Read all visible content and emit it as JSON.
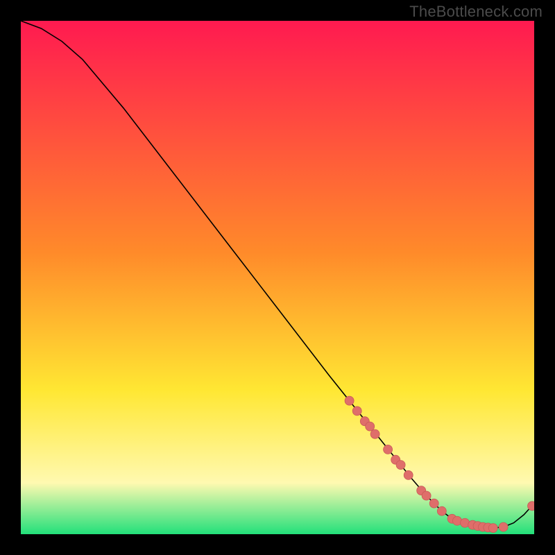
{
  "watermark": "TheBottleneck.com",
  "colors": {
    "frame_bg": "#000000",
    "watermark": "#4b4b4b",
    "curve": "#000000",
    "marker_fill": "#df6e6a",
    "marker_stroke": "#c95b57",
    "grad_top": "#ff1a50",
    "grad_mid1": "#ff8a2a",
    "grad_mid2": "#ffe733",
    "grad_mid3": "#fff9b0",
    "grad_bot": "#22e07a"
  },
  "chart_data": {
    "type": "line",
    "title": "",
    "xlabel": "",
    "ylabel": "",
    "xlim": [
      0,
      100
    ],
    "ylim": [
      0,
      100
    ],
    "legend": false,
    "grid": false,
    "series": [
      {
        "name": "bottleneck-curve",
        "x": [
          0,
          4,
          8,
          12,
          20,
          30,
          40,
          50,
          60,
          64,
          68,
          72,
          76,
          79,
          82,
          84,
          86,
          88,
          90,
          92,
          94,
          96,
          98,
          100
        ],
        "y": [
          100,
          98.5,
          96,
          92.5,
          83,
          70,
          57,
          44,
          31,
          26,
          21,
          16,
          11,
          7.5,
          4.5,
          3,
          2.1,
          1.6,
          1.3,
          1.2,
          1.4,
          2.2,
          3.8,
          6
        ]
      }
    ],
    "markers": {
      "name": "highlighted-points",
      "x": [
        64,
        65.5,
        67,
        68,
        69,
        71.5,
        73,
        74,
        75.5,
        78,
        79,
        80.5,
        82,
        84,
        85,
        86.5,
        88,
        89,
        90,
        91,
        92,
        94,
        99.6
      ],
      "y": [
        26,
        24,
        22,
        21,
        19.5,
        16.5,
        14.5,
        13.5,
        11.5,
        8.5,
        7.5,
        6,
        4.5,
        3,
        2.6,
        2.2,
        1.8,
        1.6,
        1.4,
        1.3,
        1.2,
        1.4,
        5.5
      ]
    }
  }
}
